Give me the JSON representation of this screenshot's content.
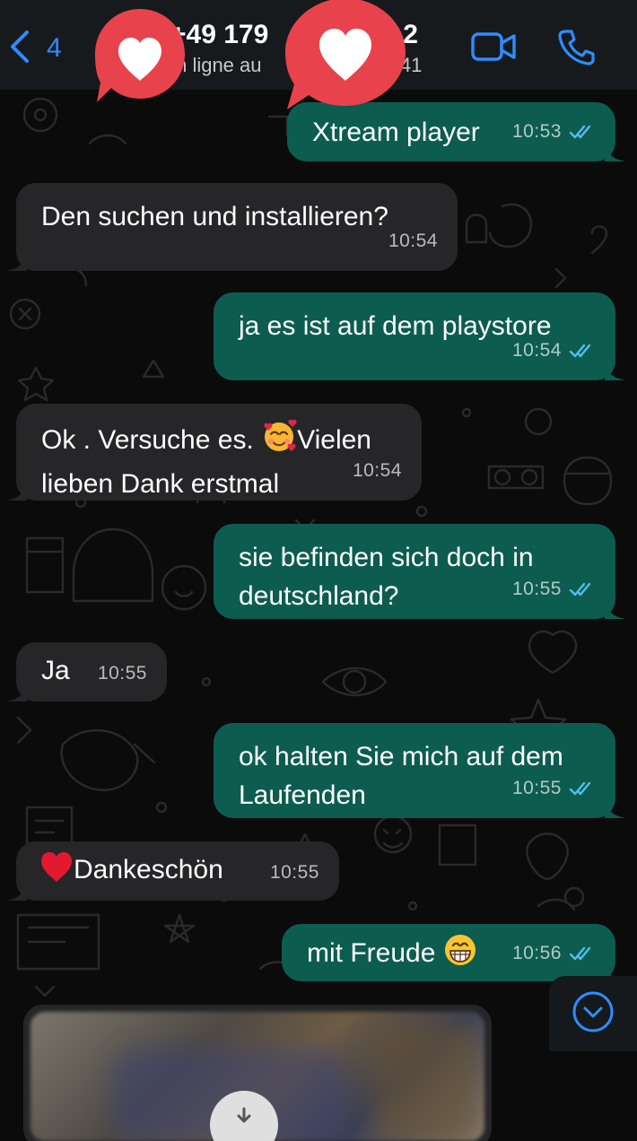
{
  "header": {
    "back_count": "4",
    "contact_name": "+49 179",
    "contact_name_suffix": "2",
    "status_prefix": "m ligne au",
    "status_suffix": "3:41",
    "accent_color": "#2f8cff",
    "icons": [
      "chevron-left-icon",
      "video-call-icon",
      "phone-icon"
    ]
  },
  "stickers": [
    "heart-sticker",
    "heart-sticker"
  ],
  "messages": [
    {
      "direction": "out",
      "text": "Xtream player",
      "time": "10:53",
      "status": "read"
    },
    {
      "direction": "in",
      "text": "Den suchen und installieren?",
      "time": "10:54"
    },
    {
      "direction": "out",
      "text": "ja es ist auf dem playstore",
      "time": "10:54",
      "status": "read"
    },
    {
      "direction": "in",
      "text_before_emoji": "Ok . Versuche es. ",
      "emoji": "smiling-face-with-hearts",
      "text_after_emoji": "Vielen",
      "text_line2": "lieben Dank erstmal",
      "time": "10:54"
    },
    {
      "direction": "out",
      "text_line1": "sie befinden sich doch in",
      "text_line2": "deutschland?",
      "time": "10:55",
      "status": "read"
    },
    {
      "direction": "in",
      "text": "Ja",
      "time": "10:55"
    },
    {
      "direction": "out",
      "text_line1": "ok halten Sie mich auf dem",
      "text_line2": "Laufenden",
      "time": "10:55",
      "status": "read"
    },
    {
      "direction": "in",
      "emoji": "red-heart",
      "text": "Dankeschön",
      "time": "10:55"
    },
    {
      "direction": "out",
      "text": "mit Freude ",
      "emoji": "grinning-face",
      "time": "10:56",
      "status": "read"
    }
  ],
  "image_message": {
    "icon": "download-icon"
  },
  "scroll_button": {
    "icon": "chevron-down-circle-icon"
  },
  "colors": {
    "outgoing_bubble": "#0d5c50",
    "incoming_bubble": "#262628",
    "read_ticks": "#53bdeb",
    "sticker_red": "#e8434c"
  }
}
